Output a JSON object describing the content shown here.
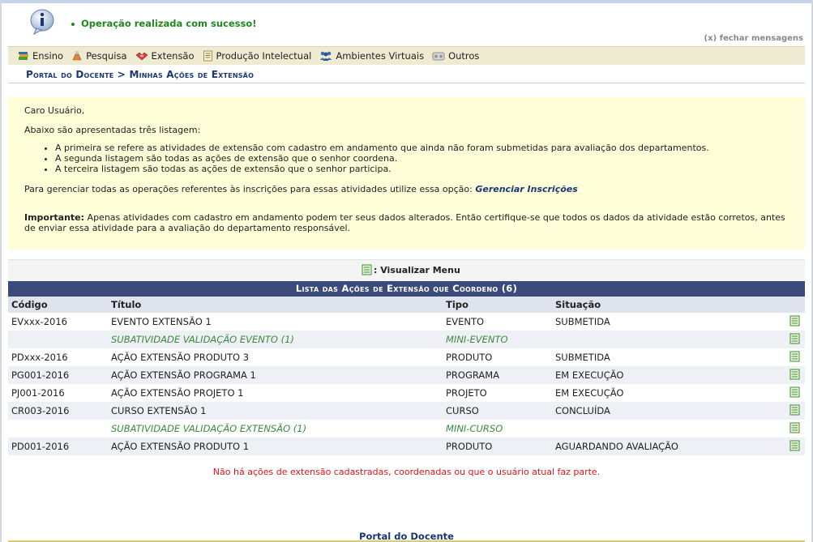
{
  "message": {
    "text": "Operação realizada com sucesso!",
    "close_label": "(x) fechar mensagens",
    "icon": "info-icon"
  },
  "menu": {
    "items": [
      {
        "label": "Ensino",
        "icon": "book-icon"
      },
      {
        "label": "Pesquisa",
        "icon": "flask-icon"
      },
      {
        "label": "Extensão",
        "icon": "extension-icon"
      },
      {
        "label": "Produção Intelectual",
        "icon": "document-icon"
      },
      {
        "label": "Ambientes Virtuais",
        "icon": "people-icon"
      },
      {
        "label": "Outros",
        "icon": "tools-icon"
      }
    ]
  },
  "breadcrumb": {
    "text": "Portal do Docente > Minhas Ações de Extensão"
  },
  "intro": {
    "greeting": "Caro Usuário,",
    "lead": "Abaixo são apresentadas três listagem:",
    "bullets": [
      "A primeira se refere as atividades de extensão com cadastro em andamento que ainda não foram submetidas para avaliação dos departamentos.",
      "A segunda listagem são todas as ações de extensão que o senhor coordena.",
      "A terceira listagem são todas as ações de extensão que o senhor participa."
    ],
    "manage_text": "Para gerenciar todas as operações referentes às inscrições para essas atividades utilize essa opção: ",
    "manage_link": "Gerenciar Inscrições",
    "important_label": "Importante:",
    "important_text": " Apenas atividades com cadastro em andamento podem ter seus dados alterados. Então certifique-se que todos os dados da atividade estão corretos, antes de enviar essa atividade para a avaliação do departamento responsável."
  },
  "view_menu": {
    "label": ": Visualizar Menu"
  },
  "table": {
    "caption": "Lista das Ações de Extensão que Coordeno (6)",
    "headers": [
      "Código",
      "Título",
      "Tipo",
      "Situação"
    ],
    "rows": [
      {
        "code": "EVxxx-2016",
        "title": "EVENTO EXTENSÃO 1",
        "type": "EVENTO",
        "status": "SUBMETIDA",
        "sub": false
      },
      {
        "code": "",
        "title": "SUBATIVIDADE VALIDAÇÃO EVENTO (1)",
        "type": "MINI-EVENTO",
        "status": "",
        "sub": true
      },
      {
        "code": "PDxxx-2016",
        "title": "AÇÃO EXTENSÃO PRODUTO 3",
        "type": "PRODUTO",
        "status": "SUBMETIDA",
        "sub": false
      },
      {
        "code": "PG001-2016",
        "title": "AÇÃO EXTENSÃO PROGRAMA 1",
        "type": "PROGRAMA",
        "status": "EM EXECUÇÃO",
        "sub": false
      },
      {
        "code": "PJ001-2016",
        "title": "AÇÃO EXTENSÃO PROJETO 1",
        "type": "PROJETO",
        "status": "EM EXECUÇÃO",
        "sub": false
      },
      {
        "code": "CR003-2016",
        "title": "CURSO EXTENSÃO 1",
        "type": "CURSO",
        "status": "CONCLUÍDA",
        "sub": false
      },
      {
        "code": "",
        "title": "SUBATIVIDADE VALIDAÇÃO EXTENSÃO (1)",
        "type": "MINI-CURSO",
        "status": "",
        "sub": true
      },
      {
        "code": "PD001-2016",
        "title": "AÇÃO EXTENSÃO PRODUTO 1",
        "type": "PRODUTO",
        "status": "AGUARDANDO AVALIAÇÃO",
        "sub": false
      }
    ]
  },
  "empty_note": "Não há ações de extensão cadastradas, coordenadas ou que o usuário atual faz parte.",
  "footer": "Portal do Docente",
  "colors": {
    "success": "#1e8a1e",
    "header_bar": "#3a4a7a",
    "link": "#1a3773",
    "error": "#d41818",
    "subitem": "#3a8a3a"
  }
}
